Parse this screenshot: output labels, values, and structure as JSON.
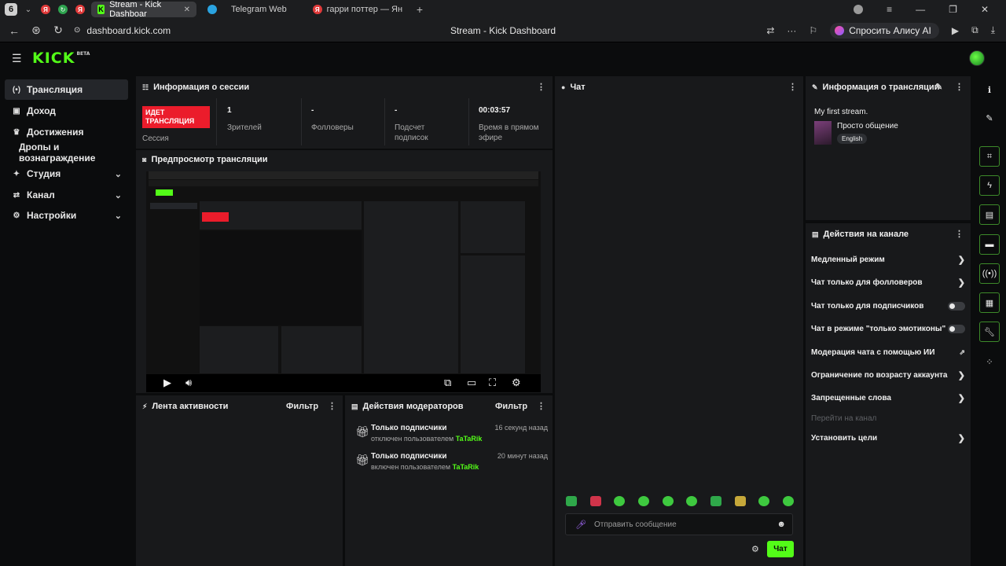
{
  "browser": {
    "tab_count": "6",
    "tabs": [
      {
        "label": "Stream - Kick Dashboar"
      },
      {
        "label": "Telegram Web"
      },
      {
        "label": "гарри поттер — Яндекс: н"
      }
    ],
    "url": "dashboard.kick.com",
    "page_title": "Stream - Kick Dashboard",
    "alice_label": "Спросить Алису AI"
  },
  "sidebar": {
    "items": [
      {
        "label": "Трансляция"
      },
      {
        "label": "Доход"
      },
      {
        "label": "Достижения"
      },
      {
        "label": "Дропы и вознаграждение"
      },
      {
        "label": "Студия"
      },
      {
        "label": "Канал"
      },
      {
        "label": "Настройки"
      }
    ]
  },
  "session": {
    "title": "Информация о сессии",
    "live_badge": "ИДЕТ ТРАНСЛЯЦИЯ",
    "session_label": "Сессия",
    "stats": [
      {
        "value": "1",
        "label": "Зрителей"
      },
      {
        "value": "-",
        "label": "Фолловеры"
      },
      {
        "value": "-",
        "label": "Подсчет подписок"
      },
      {
        "value": "00:03:57",
        "label": "Время в прямом эфире"
      }
    ]
  },
  "preview": {
    "title": "Предпросмотр трансляции"
  },
  "activity": {
    "title": "Лента активности",
    "filter": "Фильтр"
  },
  "mod_actions": {
    "title": "Действия модераторов",
    "filter": "Фильтр",
    "items": [
      {
        "title": "Только подписчики",
        "sub": "отключен пользователем",
        "user": "TaTaRik",
        "time": "16 секунд назад"
      },
      {
        "title": "Только подписчики",
        "sub": "включен пользователем",
        "user": "TaTaRik",
        "time": "20 минут назад"
      }
    ]
  },
  "chat": {
    "title": "Чат",
    "placeholder": "Отправить сообщение",
    "send_label": "Чат"
  },
  "stream_info": {
    "title": "Информация о трансляции",
    "stream_title": "My first stream.",
    "category": "Просто общение",
    "language": "English"
  },
  "channel_actions": {
    "title": "Действия на канале",
    "items": [
      {
        "label": "Медленный режим",
        "control": "arrow"
      },
      {
        "label": "Чат только для фолловеров",
        "control": "arrow"
      },
      {
        "label": "Чат только для подписчиков",
        "control": "toggle"
      },
      {
        "label": "Чат в режиме \"только эмотиконы\"",
        "control": "toggle"
      },
      {
        "label": "Модерация чата с помощью ИИ",
        "control": "external"
      },
      {
        "label": "Ограничение по возрасту аккаунта",
        "control": "arrow"
      },
      {
        "label": "Запрещенные слова",
        "control": "arrow"
      },
      {
        "label": "Перейти на канал",
        "control": "disabled"
      },
      {
        "label": "Установить цели",
        "control": "arrow"
      }
    ]
  },
  "colors": {
    "accent": "#53fc18",
    "live": "#eb1c2b",
    "panel": "#18191b",
    "background": "#0b0c0d"
  }
}
